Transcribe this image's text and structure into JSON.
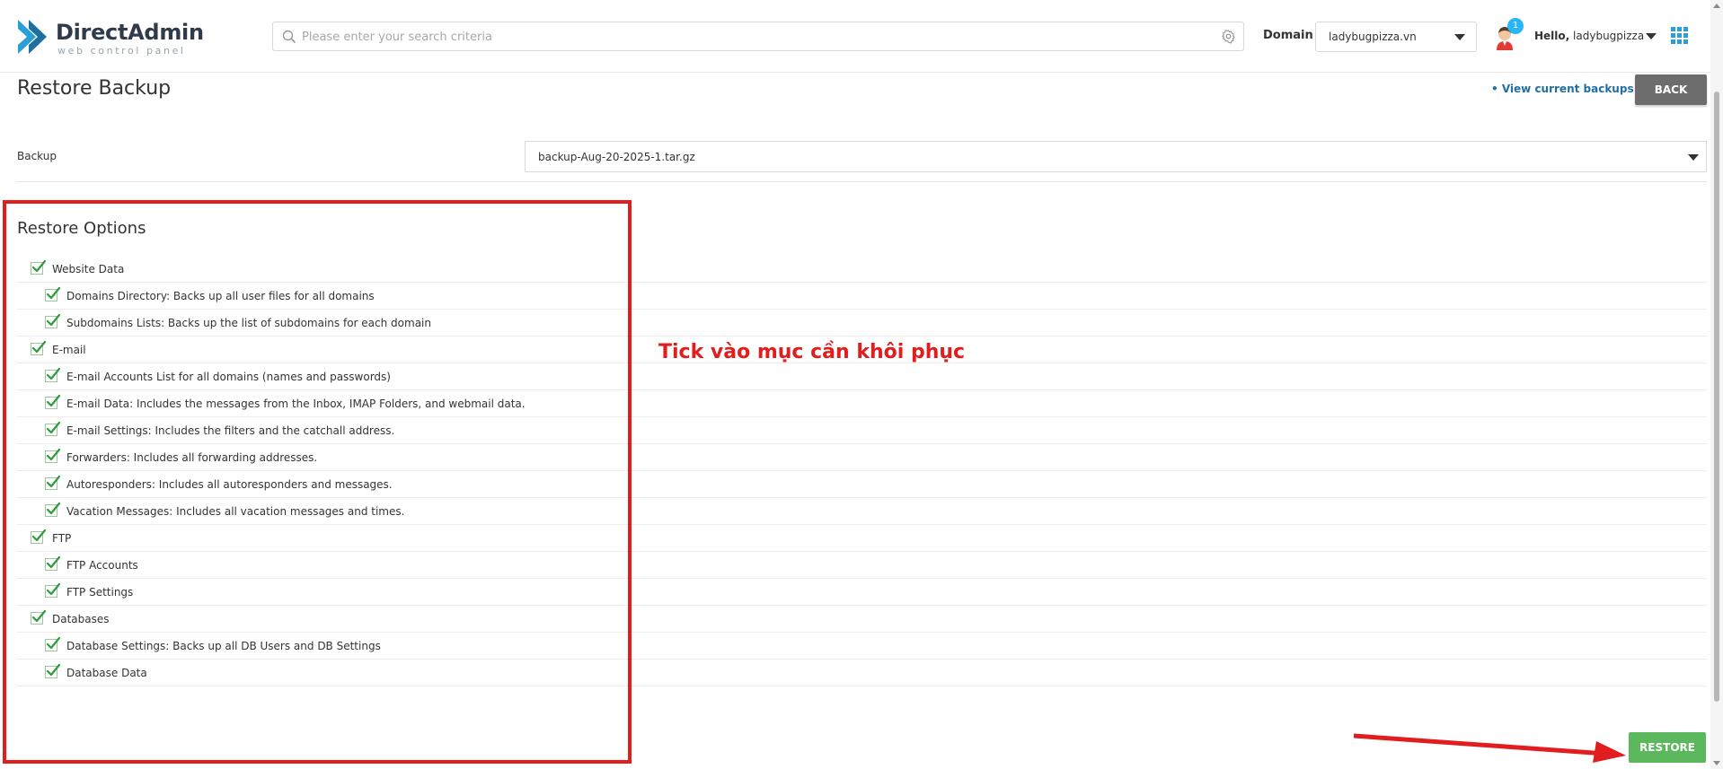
{
  "brand": {
    "title": "DirectAdmin",
    "subtitle": "web control panel"
  },
  "search": {
    "placeholder": "Please enter your search criteria"
  },
  "domain": {
    "label": "Domain",
    "selected": "ladybugpizza.vn"
  },
  "user": {
    "greeting": "Hello,",
    "name": "ladybugpizza",
    "notifications": "1"
  },
  "page": {
    "title": "Restore Backup",
    "view_backups_link": "• View current backups",
    "back_button": "BACK"
  },
  "backup": {
    "label": "Backup",
    "selected": "backup-Aug-20-2025-1.tar.gz"
  },
  "restore_options": {
    "title": "Restore Options",
    "items": [
      {
        "label": "Website Data",
        "checked": true,
        "level": 0
      },
      {
        "label": "Domains Directory: Backs up all user files for all domains",
        "checked": true,
        "level": 1
      },
      {
        "label": "Subdomains Lists: Backs up the list of subdomains for each domain",
        "checked": true,
        "level": 1
      },
      {
        "label": "E-mail",
        "checked": true,
        "level": 0
      },
      {
        "label": "E-mail Accounts List for all domains (names and passwords)",
        "checked": true,
        "level": 1
      },
      {
        "label": "E-mail Data: Includes the messages from the Inbox, IMAP Folders, and webmail data.",
        "checked": true,
        "level": 1
      },
      {
        "label": "E-mail Settings: Includes the filters and the catchall address.",
        "checked": true,
        "level": 1
      },
      {
        "label": "Forwarders: Includes all forwarding addresses.",
        "checked": true,
        "level": 1
      },
      {
        "label": "Autoresponders: Includes all autoresponders and messages.",
        "checked": true,
        "level": 1
      },
      {
        "label": "Vacation Messages: Includes all vacation messages and times.",
        "checked": true,
        "level": 1
      },
      {
        "label": "FTP",
        "checked": true,
        "level": 0
      },
      {
        "label": "FTP Accounts",
        "checked": true,
        "level": 1
      },
      {
        "label": "FTP Settings",
        "checked": true,
        "level": 1
      },
      {
        "label": "Databases",
        "checked": true,
        "level": 0
      },
      {
        "label": "Database Settings: Backs up all DB Users and DB Settings",
        "checked": true,
        "level": 1
      },
      {
        "label": "Database Data",
        "checked": true,
        "level": 1
      }
    ]
  },
  "annotation": {
    "note": "Tick vào mục cần khôi phục",
    "color": "#e11d1d"
  },
  "actions": {
    "restore_button": "RESTORE"
  },
  "colors": {
    "accent": "#2a9fd6",
    "success": "#5cb85c",
    "back_button": "#6d6d6d"
  }
}
